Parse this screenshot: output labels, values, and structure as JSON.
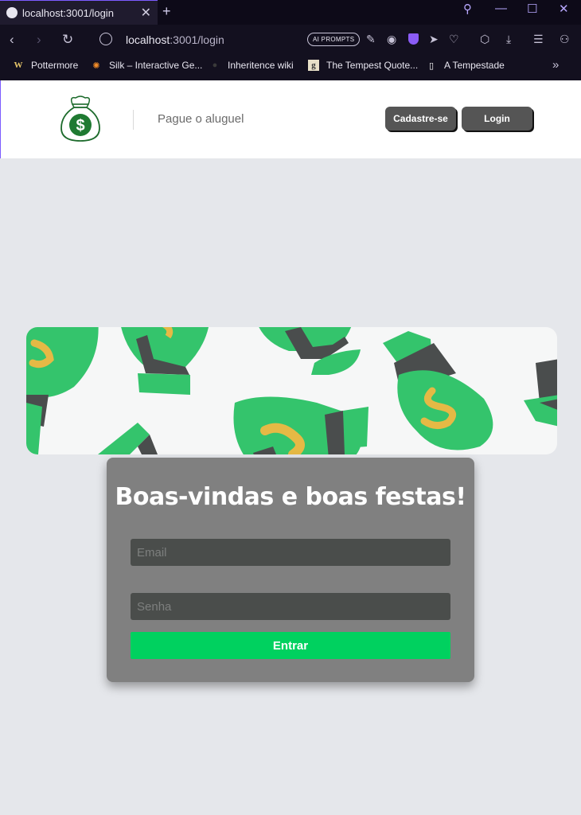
{
  "browser": {
    "tab_title": "localhost:3001/login",
    "url_host": "localhost",
    "url_rest": ":3001/login",
    "ai_prompts_label": "AI PROMPTS",
    "bookmarks": [
      {
        "label": "Pottermore",
        "icon": "W"
      },
      {
        "label": "Silk – Interactive Ge...",
        "icon": "✺"
      },
      {
        "label": "Inheritence wiki",
        "icon": "●"
      },
      {
        "label": "The Tempest Quote...",
        "icon": "g"
      },
      {
        "label": "A Tempestade",
        "icon": "▯"
      }
    ]
  },
  "header": {
    "tagline": "Pague o aluguel",
    "signup_label": "Cadastre-se",
    "login_label": "Login"
  },
  "login": {
    "heading": "Boas-vindas e boas festas!",
    "email_placeholder": "Email",
    "password_placeholder": "Senha",
    "submit_label": "Entrar"
  },
  "colors": {
    "accent_green": "#00d15f",
    "card_bg": "#808080",
    "page_bg": "#e5e7eb"
  }
}
